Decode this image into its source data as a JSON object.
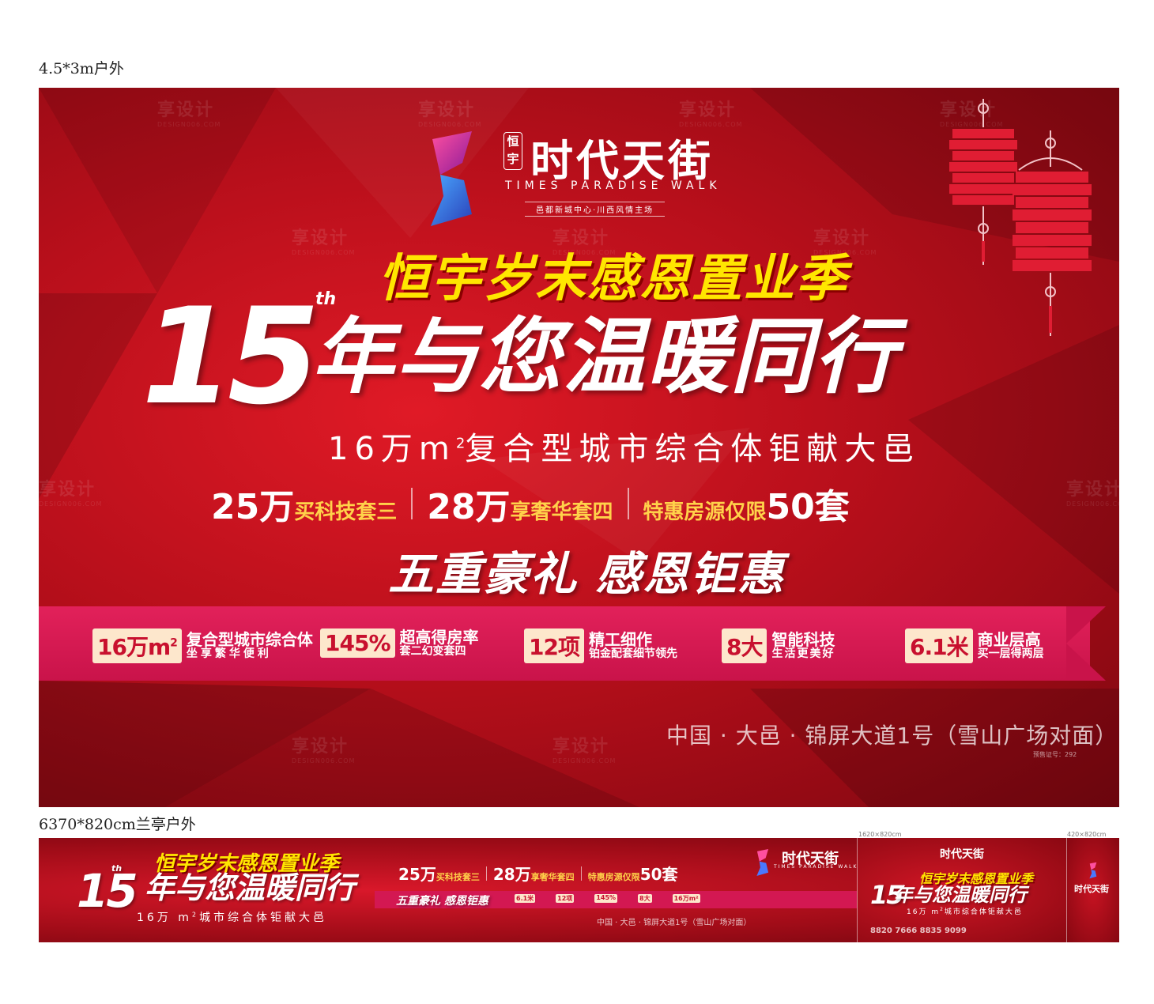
{
  "labels": {
    "top_spec": "4.5*3m户外",
    "bottom_spec": "6370*820cm兰亭户外",
    "dim_a": "1620×820cm",
    "dim_b": "420×820cm"
  },
  "watermark": {
    "cn": "享设计",
    "en": "DESIGN006.COM"
  },
  "brand": {
    "seal": "恒宇",
    "name_cn": "时代天街",
    "name_en": "TIMES PARADISE WALK",
    "tagline": "邑都新城中心·川西风情主场"
  },
  "headline": {
    "yellow": "恒宇岁末感恩置业季",
    "number": "15",
    "suffix": "th",
    "main": "年与您温暖同行",
    "sub_pre": "16万m",
    "sub_sup": "2",
    "sub_post": "复合型城市综合体钜献大邑",
    "sub_short_pre": "16万 m",
    "sub_short_post": "城市综合体钜献大邑"
  },
  "offers": [
    {
      "big": "25万",
      "small": "买科技套三"
    },
    {
      "big": "28万",
      "small": "享奢华套四"
    },
    {
      "small": "特惠房源仅限",
      "big": "50套"
    }
  ],
  "gift": "五重豪礼 感恩钜惠",
  "features": [
    {
      "box": "16万m",
      "box_sup": "2",
      "t1": "复合型城市综合体",
      "t2": "坐享繁华便利"
    },
    {
      "box": "145%",
      "t1": "超高得房率",
      "t2": "套二幻变套四"
    },
    {
      "box": "12项",
      "t1": "精工细作",
      "t2": "铂金配套细节领先"
    },
    {
      "box": "8大",
      "t1": "智能科技",
      "t2": "生活更美好"
    },
    {
      "box": "6.1米",
      "t1": "商业层高",
      "t2": "买一层得两层"
    }
  ],
  "strip_features": [
    "6.1米",
    "12项",
    "145%",
    "8大",
    "16万m²"
  ],
  "address": "中国 · 大邑 · 锦屏大道1号（雪山广场对面）",
  "permit": "预售证号：292",
  "phone": "8820 7666  8835 9099",
  "colors": {
    "red": "#c8102e",
    "yellow": "#ffe600",
    "pink": "#d31852",
    "cream": "#fde7cc"
  }
}
